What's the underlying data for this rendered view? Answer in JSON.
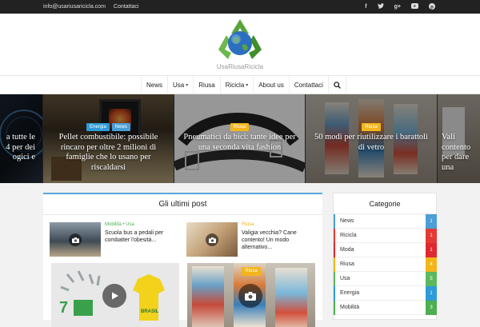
{
  "topbar": {
    "email": "info@usariusaricicla.com",
    "contact": "Contattaci"
  },
  "site": {
    "name": "UsaRiusaRicicla"
  },
  "nav": {
    "items": [
      {
        "label": "News"
      },
      {
        "label": "Usa"
      },
      {
        "label": "Riusa"
      },
      {
        "label": "Ricicla"
      },
      {
        "label": "About us"
      },
      {
        "label": "Contattaci"
      }
    ]
  },
  "slider": {
    "slides": [
      {
        "title": "a tutte le\n4 per dei\nogici e"
      },
      {
        "categories": [
          "Energia",
          "News"
        ],
        "title": "Pellet combustibile: possibile rincaro per oltre 2 milioni di famiglie che lo usano per riscaldarsi"
      },
      {
        "categories": [
          "Riusa"
        ],
        "title": "Pneumatici da bici: tante idee per una seconda vita fashion"
      },
      {
        "categories": [
          "Riusa"
        ],
        "title": "50 modi per riutilizzare i barattoli di vetro"
      },
      {
        "title": "Vali\ncontento\nper dare\nuna"
      }
    ]
  },
  "latest": {
    "heading": "Gli ultimi post",
    "posts": [
      {
        "categories": "Mobilità • Usa",
        "title": "Scuola bus a pedali per combatter l'obesità..."
      },
      {
        "categories": "Riusa",
        "title": "Valigia vecchia? Cane contento! Un modo alternativo..."
      }
    ],
    "featured": [
      {
        "categories": []
      },
      {
        "categories": [
          "Riusa"
        ]
      }
    ]
  },
  "sidebar": {
    "heading": "Categorie",
    "categories": [
      {
        "name": "News",
        "count": "1",
        "color": "#4a9fd6"
      },
      {
        "name": "Ricicla",
        "count": "1",
        "color": "#e53935"
      },
      {
        "name": "Moda",
        "count": "1",
        "color": "#e0282f"
      },
      {
        "name": "Riusa",
        "count": "4",
        "color": "#f2b51c"
      },
      {
        "name": "Usa",
        "count": "5",
        "color": "#5cb85c"
      },
      {
        "name": "Energia",
        "count": "1",
        "color": "#2e9bd8"
      },
      {
        "name": "Mobilità",
        "count": "3",
        "color": "#4caf50"
      }
    ]
  },
  "colors": {
    "accent": "#5aa6d8",
    "badge_energia": "#2e9bd8",
    "badge_news": "#4a9fd6",
    "badge_riusa": "#f2b51c"
  },
  "icons": [
    "facebook-icon",
    "twitter-icon",
    "google-plus-icon",
    "youtube-icon",
    "pinterest-icon",
    "search-icon",
    "camera-icon",
    "play-icon"
  ]
}
